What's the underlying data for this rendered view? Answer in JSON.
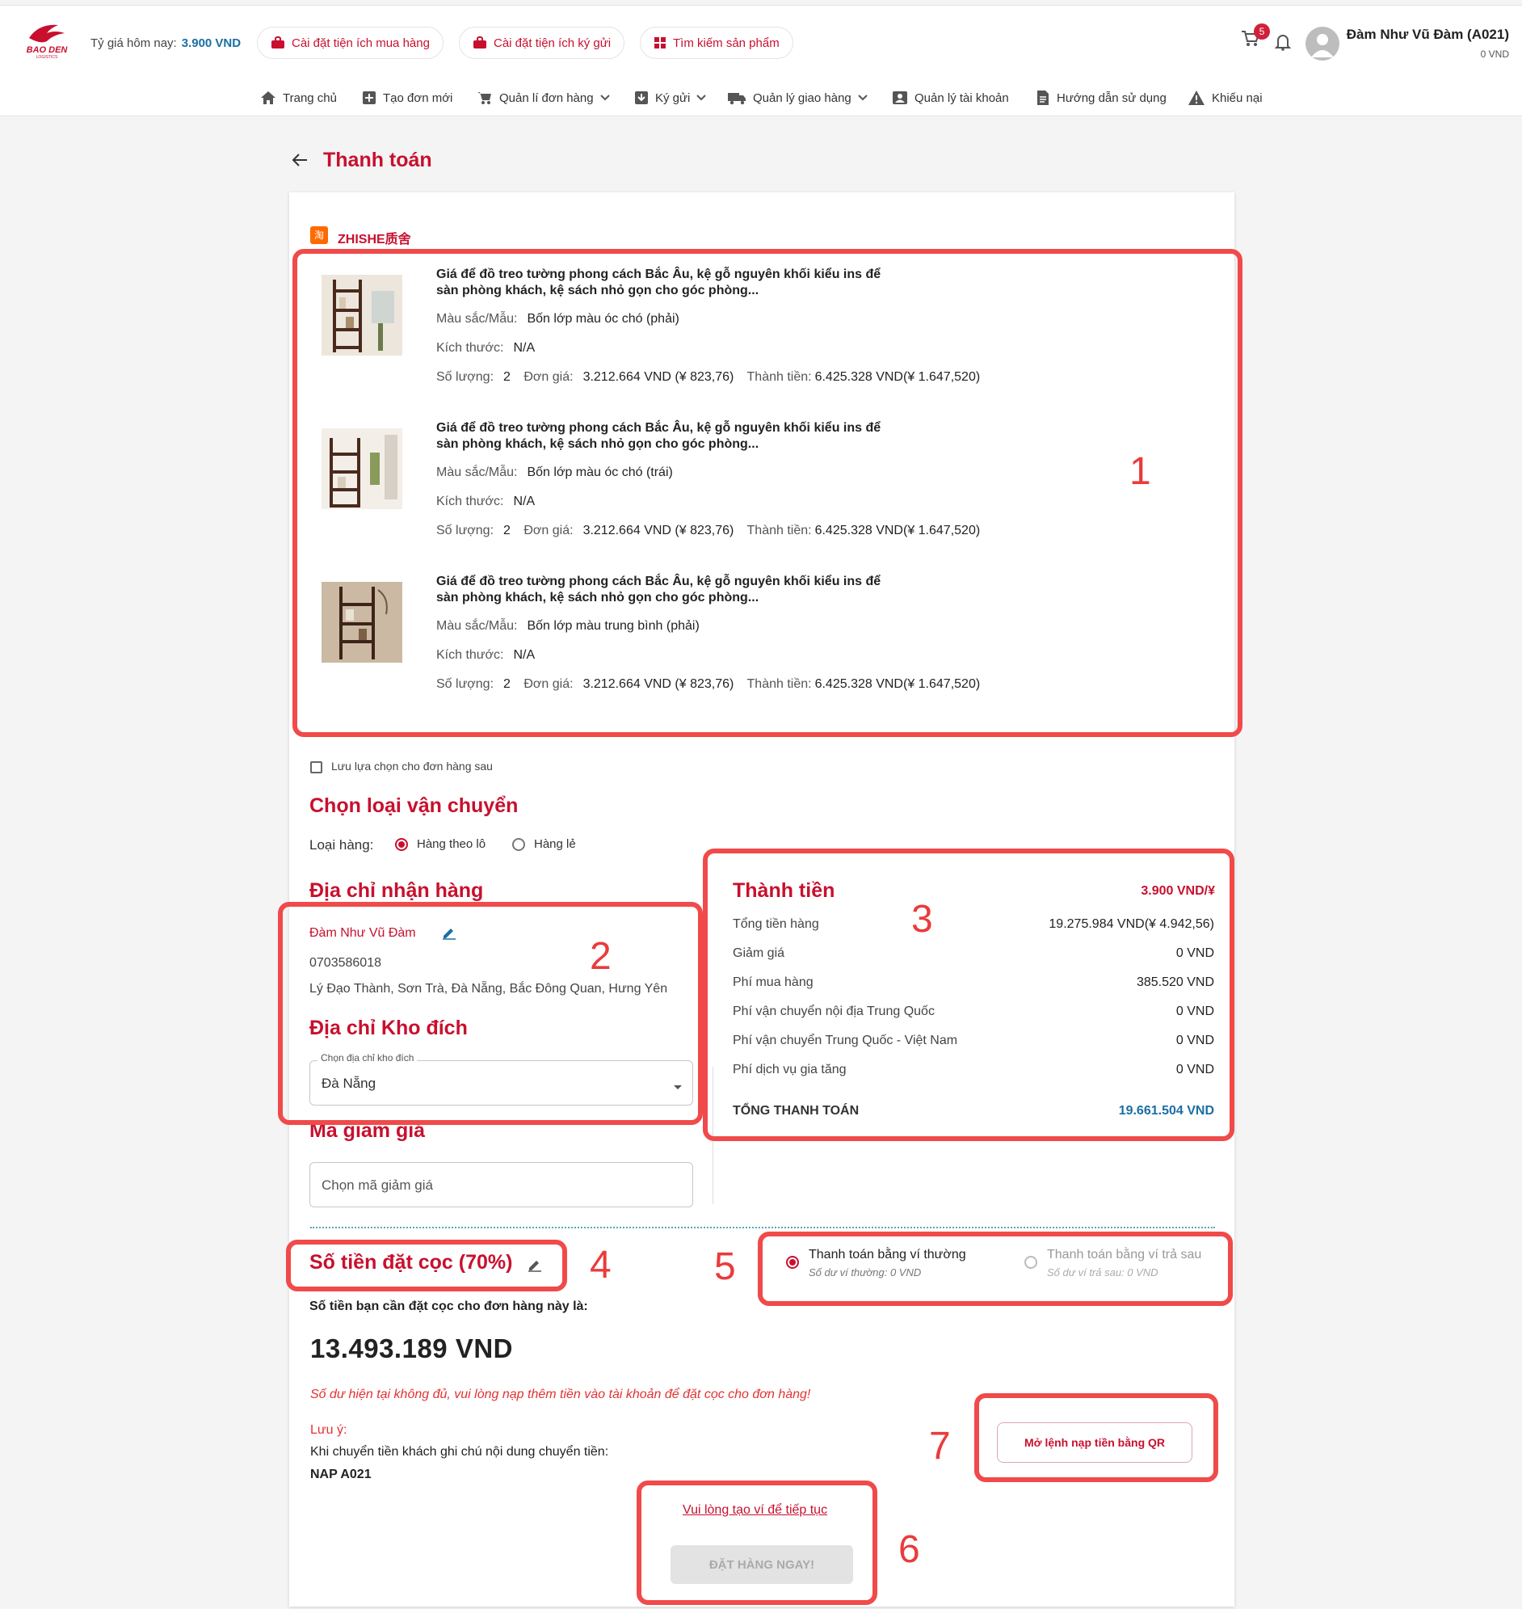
{
  "header": {
    "rate_label": "Tỷ giá hôm nay:",
    "rate_value": "3.900 VND",
    "pills": [
      "Cài đặt tiện ích mua hàng",
      "Cài đặt tiện ích ký gửi",
      "Tìm kiếm sản phẩm"
    ],
    "cart_count": "5",
    "user_name": "Đàm Như Vũ Đàm (A021)",
    "user_balance": "0 VND"
  },
  "nav": [
    "Trang chủ",
    "Tạo đơn mới",
    "Quản lí đơn hàng",
    "Ký gửi",
    "Quản lý giao hàng",
    "Quản lý tài khoản",
    "Hướng dẫn sử dụng",
    "Khiếu nại"
  ],
  "page": {
    "title": "Thanh toán"
  },
  "shop": {
    "icon": "淘",
    "name": "ZHISHE质舍"
  },
  "items": [
    {
      "title": "Giá để đồ treo tường phong cách Bắc Âu, kệ gỗ nguyên khối kiểu ins để sàn phòng khách, kệ sách nhỏ gọn cho góc phòng...",
      "color_label": "Màu sắc/Mẫu:",
      "color": "Bốn lớp màu óc chó (phải)",
      "size_label": "Kích thước:",
      "size": "N/A",
      "qty_label": "Số lượng:",
      "qty": "2",
      "price_label": "Đơn giá:",
      "price": "3.212.664 VND (¥ 823,76)",
      "total_label": "Thành tiền:",
      "total": "6.425.328 VND(¥ 1.647,520)"
    },
    {
      "title": "Giá để đồ treo tường phong cách Bắc Âu, kệ gỗ nguyên khối kiểu ins để sàn phòng khách, kệ sách nhỏ gọn cho góc phòng...",
      "color_label": "Màu sắc/Mẫu:",
      "color": "Bốn lớp màu óc chó (trái)",
      "size_label": "Kích thước:",
      "size": "N/A",
      "qty_label": "Số lượng:",
      "qty": "2",
      "price_label": "Đơn giá:",
      "price": "3.212.664 VND (¥ 823,76)",
      "total_label": "Thành tiền:",
      "total": "6.425.328 VND(¥ 1.647,520)"
    },
    {
      "title": "Giá để đồ treo tường phong cách Bắc Âu, kệ gỗ nguyên khối kiểu ins để sàn phòng khách, kệ sách nhỏ gọn cho góc phòng...",
      "color_label": "Màu sắc/Mẫu:",
      "color": "Bốn lớp màu trung bình (phải)",
      "size_label": "Kích thước:",
      "size": "N/A",
      "qty_label": "Số lượng:",
      "qty": "2",
      "price_label": "Đơn giá:",
      "price": "3.212.664 VND (¥ 823,76)",
      "total_label": "Thành tiền:",
      "total": "6.425.328 VND(¥ 1.647,520)"
    }
  ],
  "save_choice": "Lưu lựa chọn cho đơn hàng sau",
  "shipping": {
    "title": "Chọn loại vận chuyển",
    "type_label": "Loại hàng:",
    "options": [
      "Hàng theo lô",
      "Hàng lẻ"
    ],
    "selected": "Hàng theo lô"
  },
  "address": {
    "title": "Địa chỉ nhận hàng",
    "name": "Đàm Như Vũ Đàm",
    "phone": "0703586018",
    "line": "Lý Đạo Thành, Sơn Trà, Đà Nẵng, Bắc Đông Quan, Hưng Yên"
  },
  "warehouse": {
    "title": "Địa chỉ Kho đích",
    "legend": "Chọn địa chỉ kho đích",
    "value": "Đà Nẵng"
  },
  "discount": {
    "title": "Mã giảm giá",
    "placeholder": "Chọn mã giảm giá"
  },
  "summary": {
    "title": "Thành tiền",
    "rate": "3.900 VND/¥",
    "rows": [
      {
        "label": "Tổng tiền hàng",
        "value": "19.275.984 VND(¥ 4.942,56)"
      },
      {
        "label": "Giảm giá",
        "value": "0 VND"
      },
      {
        "label": "Phí mua hàng",
        "value": "385.520 VND"
      },
      {
        "label": "Phí vận chuyển nội địa Trung Quốc",
        "value": "0 VND"
      },
      {
        "label": "Phí vận chuyển Trung Quốc - Việt Nam",
        "value": "0 VND"
      },
      {
        "label": "Phí dịch vụ gia tăng",
        "value": "0 VND"
      }
    ],
    "total_label": "TỔNG THANH TOÁN",
    "total_value": "19.661.504 VND"
  },
  "deposit": {
    "title": "Số tiền đặt cọc (70%)",
    "desc": "Số tiền bạn cần đặt cọc cho đơn hàng này là:",
    "amount": "13.493.189 VND",
    "warning": "Số dư hiện tại không đủ, vui lòng nạp thêm tiền vào tài khoản để đặt cọc cho đơn hàng!",
    "note_label": "Lưu ý:",
    "note_text": "Khi chuyển tiền khách ghi chú nội dung chuyển tiền:",
    "note_code": "NAP A021"
  },
  "wallet": {
    "normal_label": "Thanh toán bằng ví thường",
    "normal_sub": "Số dư ví thường: 0 VND",
    "later_label": "Thanh toán bằng ví trả sau",
    "later_sub": "Số dư ví trả sau: 0 VND"
  },
  "actions": {
    "qr_button": "Mở lệnh nạp tiền bằng QR",
    "create_wallet_link": "Vui lòng tạo ví để tiếp tục",
    "order_button": "ĐẶT HÀNG NGAY!"
  },
  "annotations": [
    "1",
    "2",
    "3",
    "4",
    "5",
    "6",
    "7"
  ],
  "colors": {
    "brand": "#c8102e",
    "annotation": "#f04a4a",
    "rate_blue": "#1a6fa3"
  }
}
